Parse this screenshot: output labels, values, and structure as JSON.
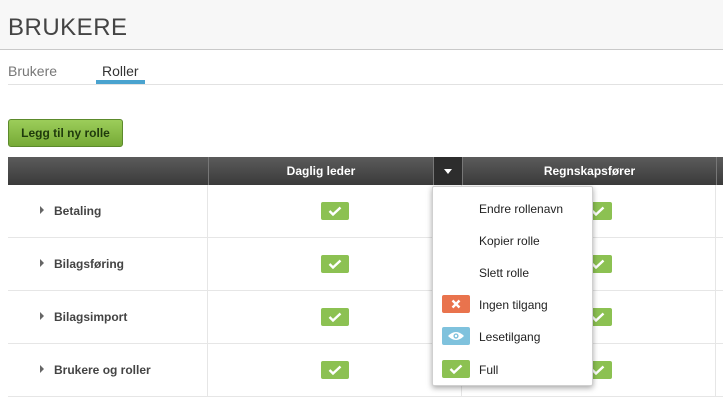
{
  "header": {
    "title": "BRUKERE"
  },
  "tabs": [
    {
      "label": "Brukere",
      "active": false
    },
    {
      "label": "Roller",
      "active": true
    }
  ],
  "toolbar": {
    "add_role_label": "Legg til ny rolle"
  },
  "table": {
    "columns": [
      "",
      "Daglig leder",
      "Regnskapsfører"
    ],
    "rows": [
      {
        "label": "Betaling",
        "permissions": [
          "full",
          "full"
        ]
      },
      {
        "label": "Bilagsføring",
        "permissions": [
          "full",
          "full"
        ]
      },
      {
        "label": "Bilagsimport",
        "permissions": [
          "full",
          "full"
        ]
      },
      {
        "label": "Brukere og roller",
        "permissions": [
          "full",
          "full"
        ]
      }
    ]
  },
  "role_menu": {
    "items": [
      {
        "label": "Endre rollenavn"
      },
      {
        "label": "Kopier rolle"
      },
      {
        "label": "Slett rolle"
      },
      {
        "label": "Ingen tilgang",
        "icon": "x-icon",
        "color": "#e9734d"
      },
      {
        "label": "Lesetilgang",
        "icon": "eye-icon",
        "color": "#7fc2dd"
      },
      {
        "label": "Full",
        "icon": "check-icon",
        "color": "#8cc152"
      }
    ]
  },
  "colors": {
    "accent": "#4aa3cf",
    "full": "#8cc152",
    "none": "#e9734d",
    "read": "#7fc2dd"
  }
}
